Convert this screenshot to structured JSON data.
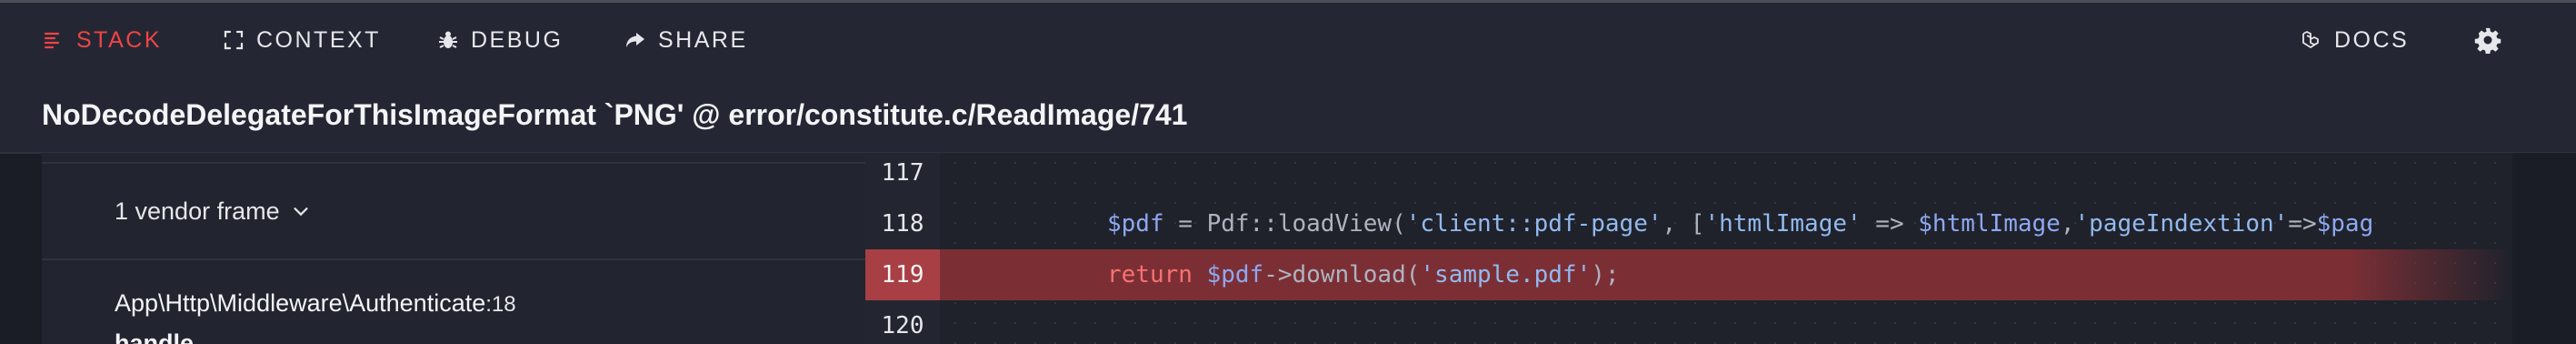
{
  "nav": {
    "items": [
      {
        "label": "STACK",
        "icon": "list-icon",
        "active": true
      },
      {
        "label": "CONTEXT",
        "icon": "frame-corners-icon",
        "active": false
      },
      {
        "label": "DEBUG",
        "icon": "bug-icon",
        "active": false
      },
      {
        "label": "SHARE",
        "icon": "share-icon",
        "active": false
      }
    ],
    "docs_label": "DOCS",
    "docs_icon": "laravel-logo-icon",
    "settings_icon": "gear-icon"
  },
  "exception": {
    "title": "NoDecodeDelegateForThisImageFormat `PNG' @ error/constitute.c/ReadImage/741"
  },
  "stack": {
    "vendor_frames_label": "1 vendor frame",
    "frame": {
      "class": "App\\Http\\Middleware\\Authenticate",
      "line": ":18",
      "method": "handle"
    }
  },
  "code": {
    "lines": [
      {
        "number": "117",
        "text": ""
      },
      {
        "number": "118",
        "text": "$pdf = Pdf::loadView('client::pdf-page', ['htmlImage' => $htmlImage,'pageIndextion'=>$pag"
      },
      {
        "number": "119",
        "text": "return $pdf->download('sample.pdf');",
        "highlighted": true
      },
      {
        "number": "120",
        "text": ""
      }
    ]
  },
  "colors": {
    "accent": "#ef4444",
    "highlight_line": "#7b2f35",
    "highlight_gutter": "#a73f44"
  }
}
